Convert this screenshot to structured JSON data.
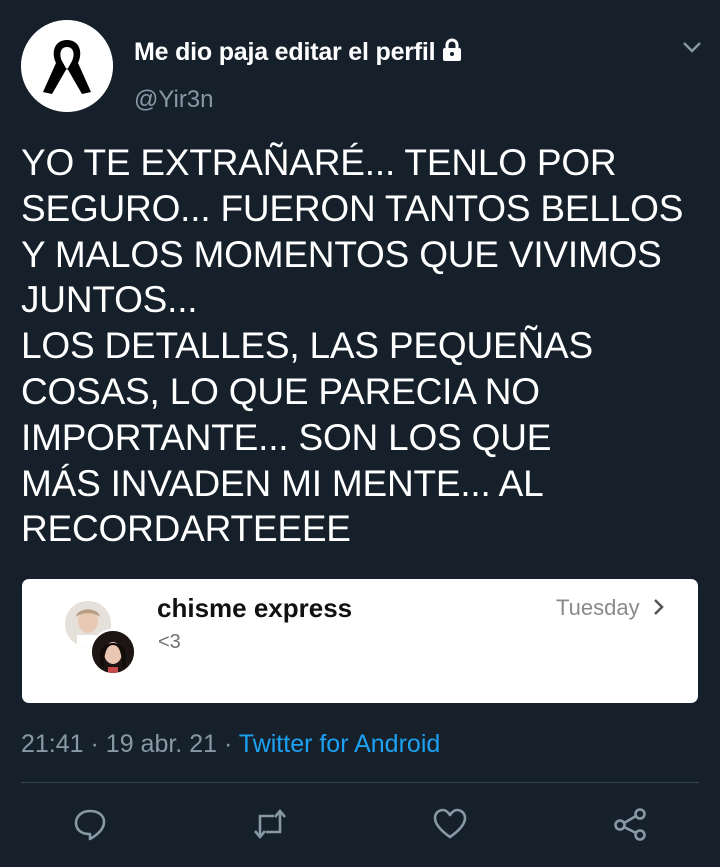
{
  "tweet": {
    "author": {
      "display_name": "Me dio paja editar el perfil",
      "handle": "@Yir3n",
      "avatar_icon": "black-ribbon-icon",
      "protected_icon": "lock-icon"
    },
    "text": "YO TE EXTRAÑARÉ... TENLO POR\nSEGURO... FUERON TANTOS BELLOS\nY MALOS MOMENTOS QUE VIVIMOS\nJUNTOS...\nLOS DETALLES, LAS PEQUEÑAS\nCOSAS, LO QUE PARECIA NO\nIMPORTANTE... SON LOS QUE\nMÁS INVADEN MI MENTE... AL\nRECORDARTEEEE",
    "attachment": {
      "title": "chisme express",
      "message": "<3",
      "date": "Tuesday"
    },
    "time": "21:41",
    "separator": "·",
    "date": "19 abr. 21",
    "source": "Twitter for Android"
  },
  "actions": {
    "reply_icon": "reply-icon",
    "retweet_icon": "retweet-icon",
    "like_icon": "heart-icon",
    "share_icon": "share-icon"
  },
  "colors": {
    "background": "#15202b",
    "secondary_text": "#8899a6",
    "link": "#1da1f2",
    "divider": "#38444d"
  }
}
